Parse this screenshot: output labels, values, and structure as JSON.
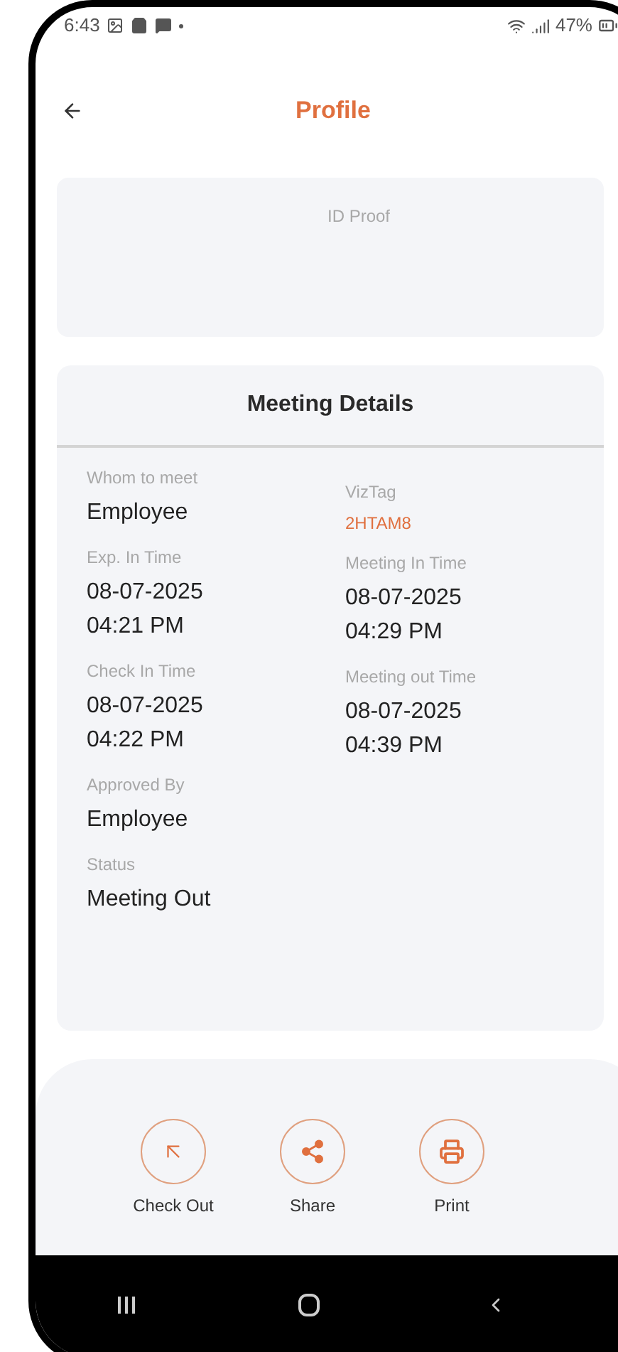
{
  "status_bar": {
    "time": "6:43",
    "battery": "47%"
  },
  "header": {
    "title": "Profile"
  },
  "id_card": {
    "label": "ID Proof"
  },
  "meeting_details": {
    "title": "Meeting Details",
    "left": [
      {
        "label": "Whom to meet",
        "value": "Employee",
        "kind": "text"
      },
      {
        "label": "Exp. In Time",
        "value": "08-07-2025\n04:21 PM",
        "kind": "text"
      },
      {
        "label": "Check In Time",
        "value": "08-07-2025\n04:22 PM",
        "kind": "text"
      },
      {
        "label": "Approved By",
        "value": "Employee",
        "kind": "text"
      },
      {
        "label": "Status",
        "value": "Meeting Out",
        "kind": "text"
      }
    ],
    "right": [
      {
        "label": "VizTag",
        "value": "2HTAM8",
        "kind": "tag"
      },
      {
        "label": "Meeting In Time",
        "value": "08-07-2025\n04:29 PM",
        "kind": "text"
      },
      {
        "label": "Meeting out Time",
        "value": "08-07-2025\n04:39 PM",
        "kind": "text"
      }
    ]
  },
  "actions": [
    {
      "label": "Check Out",
      "kind": "checkout"
    },
    {
      "label": "Share",
      "kind": "share"
    },
    {
      "label": "Print",
      "kind": "print"
    }
  ]
}
